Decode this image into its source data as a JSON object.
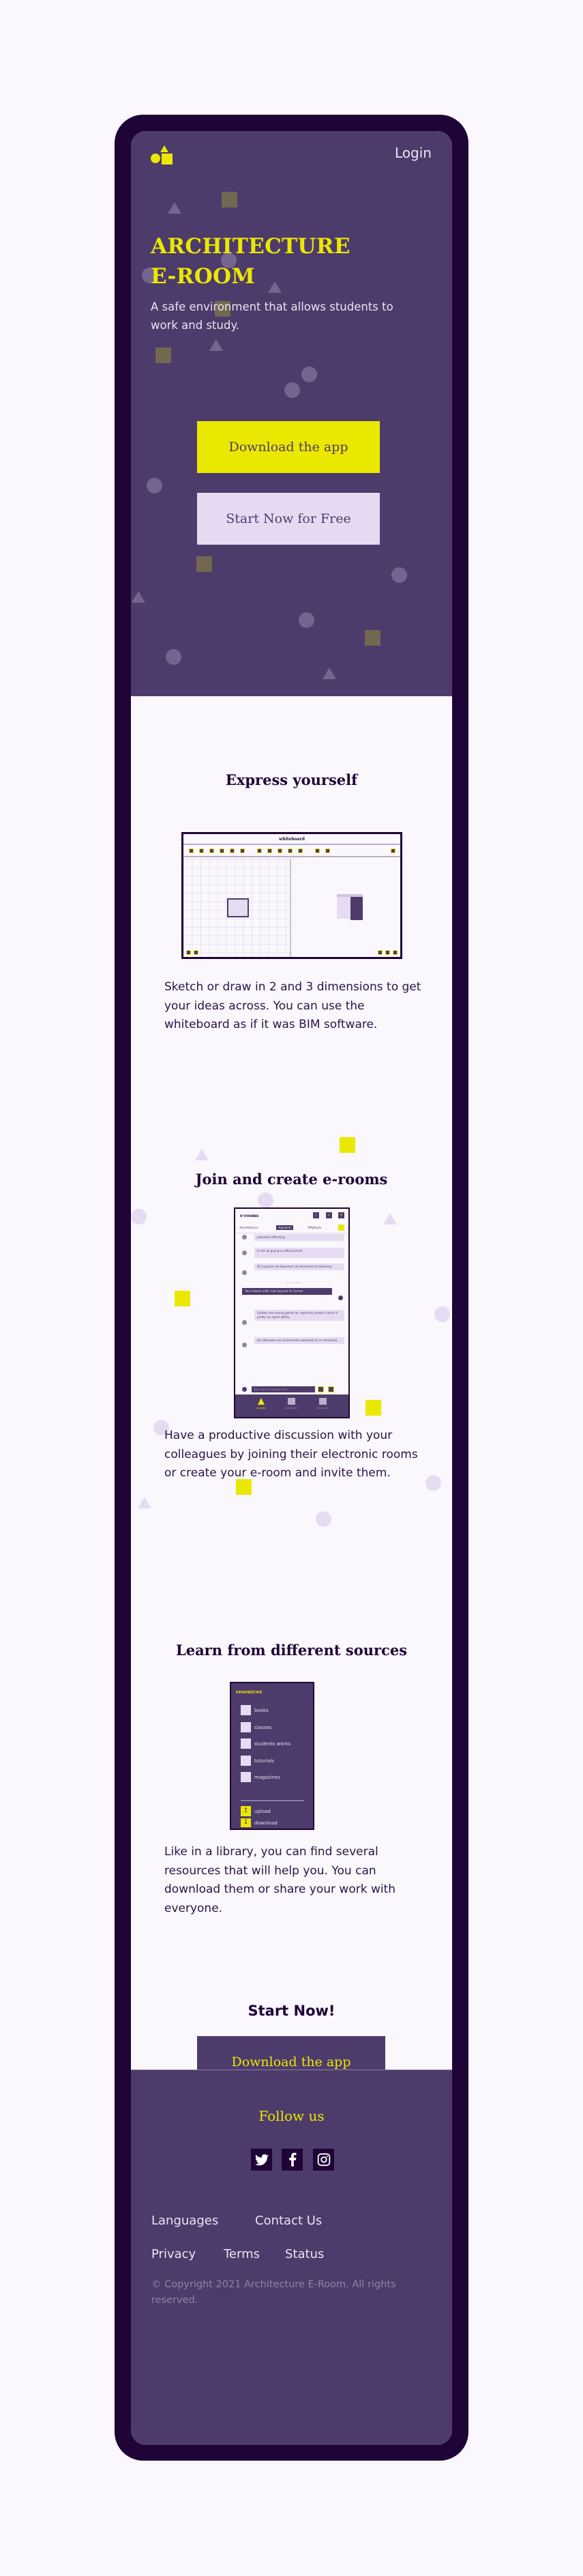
{
  "header": {
    "logo": "shapes-logo",
    "login_label": "Login"
  },
  "hero": {
    "title_line1": "ARCHITECTURE",
    "title_line2": "E-ROOM",
    "subtitle": "A safe environment that allows students to work and study.",
    "primary_button": "Download the app",
    "secondary_button": "Start Now for Free"
  },
  "features": [
    {
      "title": "Express yourself",
      "text": "Sketch or draw in 2 and 3 dimensions to get your ideas across. You can use the whiteboard as if it was BIM software.",
      "mockup": {
        "title": "whiteboard"
      }
    },
    {
      "title": "Join and create e-rooms",
      "text": "Have a productive discussion with your colleagues by joining their electronic rooms or create your e-room and invite them.",
      "mockup": {
        "title": "e-rooms",
        "tabs": [
          "#architecture",
          "#general",
          "#MyRoom"
        ],
        "active_tab": "#general",
        "messages": [
          {
            "text": "prevailed offending",
            "own": false
          },
          {
            "text": "In am do giving so afford parish",
            "own": false
          },
          {
            "text": "Of suspicion do departure at extremely he believing",
            "own": false
          },
          {
            "text": "Two indeed suffer saw beyond far former",
            "own": true
          },
          {
            "text": "Sudden she seeing garret far regard by hardly it direct if pretty up regret ability",
            "own": false
          },
          {
            "text": "He otherwise me incommode explained so in remaining",
            "own": false
          }
        ],
        "date_separator": "June 09, 2021",
        "input_placeholder": "Type your message here...",
        "nav": [
          "e-rooms",
          "whiteboard",
          "resources"
        ],
        "active_nav": "e-rooms"
      }
    },
    {
      "title": "Learn from different sources",
      "text": "Like in a library, you can find several resources that will help you. You can download them or share your work with everyone.",
      "mockup": {
        "title": "resources",
        "categories": [
          "books",
          "classes",
          "students works",
          "tutorials",
          "magazines"
        ],
        "actions": [
          "upload",
          "download"
        ]
      }
    }
  ],
  "cta": {
    "title": "Start Now!",
    "button": "Download the app"
  },
  "footer": {
    "follow_label": "Follow us",
    "social": [
      "twitter-icon",
      "facebook-icon",
      "instagram-icon"
    ],
    "links_row1": [
      "Languages",
      "Contact Us"
    ],
    "links_row2": [
      "Privacy",
      "Terms",
      "Status"
    ],
    "copyright": "© Copyright 2021 Architecture E-Room. All rights reserved."
  },
  "colors": {
    "primary_purple": "#4d3b6b",
    "dark_purple": "#1f0437",
    "accent_yellow": "#ebe800",
    "light_lavender": "#e6dcf2",
    "background": "#faf7fd"
  }
}
